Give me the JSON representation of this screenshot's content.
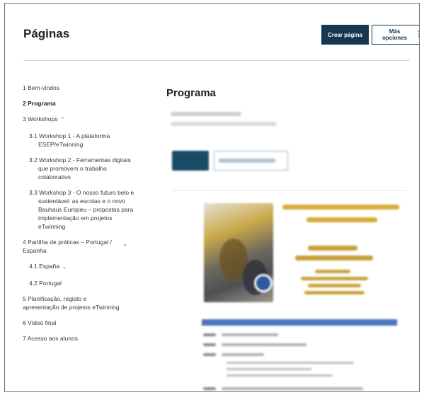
{
  "header": {
    "title": "Páginas",
    "create_label": "Crear página",
    "more_label": "Más opciones",
    "more_icon": "⋮"
  },
  "nav": {
    "items": [
      {
        "label": "1 Bem-vindos"
      },
      {
        "label": "2 Programa",
        "active": true
      },
      {
        "label": "3 Workshops",
        "expanded": true,
        "chevron": "⌃"
      },
      {
        "label": "3.1 Workshop 1 - A plataforma ESEP/eTwinning"
      },
      {
        "label": "3.2 Workshop 2 - Ferramentas digitais que promovem o trabalho colaborativo"
      },
      {
        "label": "3.3 Workshop 3 - O nosso futuro belo e sustentável: as escolas e o novo Bauhaus Europeu – propostas para implementação em projetos eTwinning"
      },
      {
        "label": "4 Partilha de práticas – Portugal / Espanha",
        "expanded": true,
        "chevron": "⌃"
      },
      {
        "label": "4.1 España",
        "chevron": "⌄"
      },
      {
        "label": "4.2 Portugal"
      },
      {
        "label": "5 Planificação, registo e apresentação de projetos eTwinning"
      },
      {
        "label": "6 Vídeo final"
      },
      {
        "label": "7 Acesso aos alunos"
      }
    ]
  },
  "content": {
    "title": "Programa"
  },
  "colors": {
    "primary": "#14384f",
    "flyer_title": "#d6a82c",
    "flyer_band": "#4b74c1"
  }
}
